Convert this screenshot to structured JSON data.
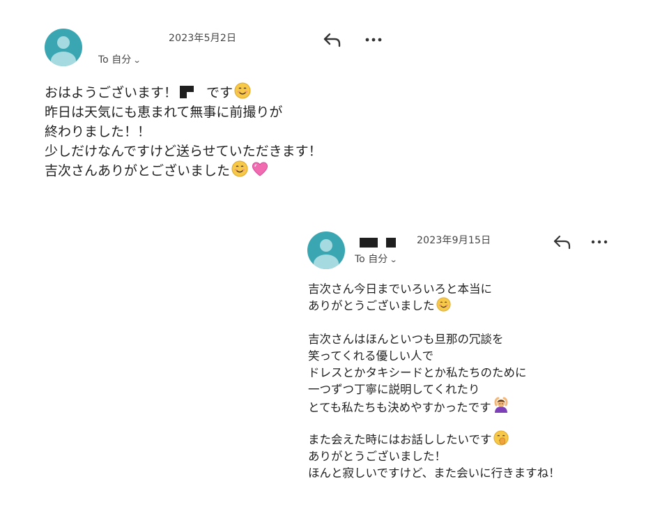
{
  "email1": {
    "date": "2023年5月2日",
    "recipient": "To 自分",
    "lines": [
      "おはようございます！",
      "です",
      "昨日は天気にも恵まれて無事に前撮りが",
      "終わりました！！",
      "少しだけなんですけど送らせていただきます！",
      "吉次さんありがとございました"
    ],
    "icons": [
      "reply-icon",
      "more-icon",
      "smile-emoji",
      "pink-heart-emoji"
    ]
  },
  "email2": {
    "date": "2023年9月15日",
    "recipient": "To 自分",
    "lines": [
      "吉次さん今日までいろいろと本当に",
      "ありがとうございました",
      "吉次さんはほんといつも旦那の冗談を",
      "笑ってくれる優しい人で",
      "ドレスとかタキシードとか私たちのために",
      "一つずつ丁寧に説明してくれたり",
      "とても私たちも決めやすかったです",
      "また会えた時にはお話ししたいです",
      "ありがとうございました！",
      "ほんと寂しいですけど、また会いに行きますね！"
    ],
    "icons": [
      "reply-icon",
      "more-icon",
      "smile-emoji",
      "person-bowing-emoji",
      "shushing-face-emoji"
    ]
  },
  "colors": {
    "avatar": "#3aa6b1",
    "avatar_glyph": "#a5dbe0",
    "text": "#1f1f1f",
    "meta": "#444444"
  }
}
